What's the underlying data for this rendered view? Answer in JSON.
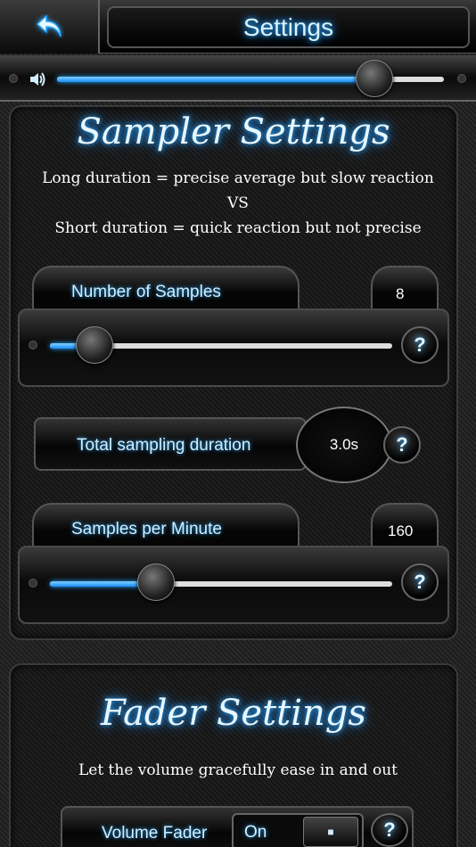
{
  "header": {
    "title": "Settings",
    "back_icon": "back-arrow-icon"
  },
  "volume": {
    "icon": "speaker-icon",
    "level": 0.82
  },
  "sampler": {
    "title": "Sampler Settings",
    "desc_line1": "Long duration = precise average but slow reaction",
    "desc_vs": "VS",
    "desc_line2": "Short duration = quick reaction but not precise",
    "num_samples_label": "Number of Samples",
    "num_samples_value": "8",
    "num_samples_level": 0.13,
    "total_duration_label": "Total sampling duration",
    "total_duration_value": "3.0s",
    "spm_label": "Samples per Minute",
    "spm_value": "160",
    "spm_level": 0.31,
    "help_label": "?"
  },
  "fader": {
    "title": "Fader Settings",
    "desc": "Let the volume gracefully ease in and out",
    "volume_fader_label": "Volume Fader",
    "toggle_state": "On",
    "toggle_thumb": "■"
  },
  "colors": {
    "accent": "#1a8cff",
    "glow": "#2aa9ff"
  }
}
